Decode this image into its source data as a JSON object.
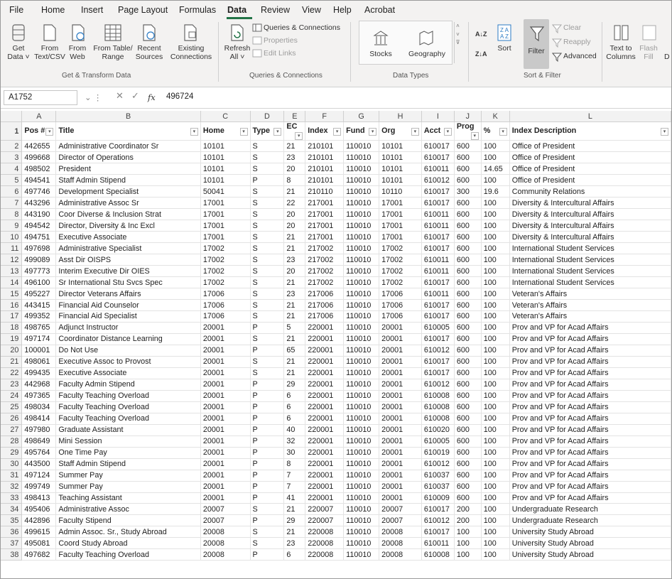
{
  "menu": {
    "tabs": [
      "File",
      "Home",
      "Insert",
      "Page Layout",
      "Formulas",
      "Data",
      "Review",
      "View",
      "Help",
      "Acrobat"
    ],
    "active": "Data"
  },
  "ribbon": {
    "get_data": [
      "Get",
      "Data ˅"
    ],
    "from_text": [
      "From",
      "Text/CSV"
    ],
    "from_web": [
      "From",
      "Web"
    ],
    "from_table": [
      "From Table/",
      "Range"
    ],
    "recent_sources": [
      "Recent",
      "Sources"
    ],
    "existing_connections": [
      "Existing",
      "Connections"
    ],
    "group_get_transform": "Get & Transform Data",
    "refresh_all": [
      "Refresh",
      "All ˅"
    ],
    "queries_connections": "Queries & Connections",
    "properties": "Properties",
    "edit_links": "Edit Links",
    "group_queries": "Queries & Connections",
    "stocks": "Stocks",
    "geography": "Geography",
    "group_data_types": "Data Types",
    "sort_az": "A↓Z",
    "sort_za": "Z↓A",
    "sort": "Sort",
    "filter": "Filter",
    "clear": "Clear",
    "reapply": "Reapply",
    "advanced": "Advanced",
    "group_sort_filter": "Sort & Filter",
    "text_to_columns": [
      "Text to",
      "Columns"
    ],
    "flash_fill": [
      "Flash",
      "Fill"
    ],
    "cut_letter": "D"
  },
  "formula_bar": {
    "name_box": "A1752",
    "fx": "fx",
    "value": "496724"
  },
  "columns": [
    "A",
    "B",
    "C",
    "D",
    "E",
    "F",
    "G",
    "H",
    "I",
    "J",
    "K",
    "L"
  ],
  "headers": [
    "Pos #",
    "Title",
    "Home",
    "Type",
    "EC",
    "Index",
    "Fund",
    "Org",
    "Acct",
    "Prog",
    "%",
    "Index Description"
  ],
  "rows": [
    [
      "442655",
      "Administrative Coordinator Sr",
      "10101",
      "S",
      "21",
      "210101",
      "110010",
      "10101",
      "610017",
      "600",
      "100",
      "Office of President"
    ],
    [
      "499668",
      "Director of Operations",
      "10101",
      "S",
      "23",
      "210101",
      "110010",
      "10101",
      "610017",
      "600",
      "100",
      "Office of President"
    ],
    [
      "498502",
      "President",
      "10101",
      "S",
      "20",
      "210101",
      "110010",
      "10101",
      "610011",
      "600",
      "14.65",
      "Office of President"
    ],
    [
      "494541",
      "Staff Admin Stipend",
      "10101",
      "P",
      "8",
      "210101",
      "110010",
      "10101",
      "610012",
      "600",
      "100",
      "Office of President"
    ],
    [
      "497746",
      "Development Specialist",
      "50041",
      "S",
      "21",
      "210110",
      "110010",
      "10110",
      "610017",
      "300",
      "19.6",
      "Community Relations"
    ],
    [
      "443296",
      "Administrative Assoc Sr",
      "17001",
      "S",
      "22",
      "217001",
      "110010",
      "17001",
      "610017",
      "600",
      "100",
      "Diversity & Intercultural Affairs"
    ],
    [
      "443190",
      "Coor Diverse & Inclusion Strat",
      "17001",
      "S",
      "20",
      "217001",
      "110010",
      "17001",
      "610011",
      "600",
      "100",
      "Diversity & Intercultural Affairs"
    ],
    [
      "494542",
      "Director, Diversity & Inc Excl",
      "17001",
      "S",
      "20",
      "217001",
      "110010",
      "17001",
      "610011",
      "600",
      "100",
      "Diversity & Intercultural Affairs"
    ],
    [
      "494751",
      "Executive Associate",
      "17001",
      "S",
      "21",
      "217001",
      "110010",
      "17001",
      "610017",
      "600",
      "100",
      "Diversity & Intercultural Affairs"
    ],
    [
      "497698",
      "Administrative Specialist",
      "17002",
      "S",
      "21",
      "217002",
      "110010",
      "17002",
      "610017",
      "600",
      "100",
      "International Student Services"
    ],
    [
      "499089",
      "Asst Dir OISPS",
      "17002",
      "S",
      "23",
      "217002",
      "110010",
      "17002",
      "610011",
      "600",
      "100",
      "International Student Services"
    ],
    [
      "497773",
      "Interim Executive Dir OIES",
      "17002",
      "S",
      "20",
      "217002",
      "110010",
      "17002",
      "610011",
      "600",
      "100",
      "International Student Services"
    ],
    [
      "496100",
      "Sr International Stu Svcs Spec",
      "17002",
      "S",
      "21",
      "217002",
      "110010",
      "17002",
      "610017",
      "600",
      "100",
      "International Student Services"
    ],
    [
      "495227",
      "Director Veterans Affairs",
      "17006",
      "S",
      "23",
      "217006",
      "110010",
      "17006",
      "610011",
      "600",
      "100",
      "Veteran's Affairs"
    ],
    [
      "443415",
      "Financial Aid Counselor",
      "17006",
      "S",
      "21",
      "217006",
      "110010",
      "17006",
      "610017",
      "600",
      "100",
      "Veteran's Affairs"
    ],
    [
      "499352",
      "Financial Aid Specialist",
      "17006",
      "S",
      "21",
      "217006",
      "110010",
      "17006",
      "610017",
      "600",
      "100",
      "Veteran's Affairs"
    ],
    [
      "498765",
      "Adjunct Instructor",
      "20001",
      "P",
      "5",
      "220001",
      "110010",
      "20001",
      "610005",
      "600",
      "100",
      "Prov and VP for Acad Affairs"
    ],
    [
      "497174",
      "Coordinator Distance Learning",
      "20001",
      "S",
      "21",
      "220001",
      "110010",
      "20001",
      "610017",
      "600",
      "100",
      "Prov and VP for Acad Affairs"
    ],
    [
      "100001",
      "Do Not Use",
      "20001",
      "P",
      "65",
      "220001",
      "110010",
      "20001",
      "610012",
      "600",
      "100",
      "Prov and VP for Acad Affairs"
    ],
    [
      "498061",
      "Executive Assoc to Provost",
      "20001",
      "S",
      "21",
      "220001",
      "110010",
      "20001",
      "610017",
      "600",
      "100",
      "Prov and VP for Acad Affairs"
    ],
    [
      "499435",
      "Executive Associate",
      "20001",
      "S",
      "21",
      "220001",
      "110010",
      "20001",
      "610017",
      "600",
      "100",
      "Prov and VP for Acad Affairs"
    ],
    [
      "442968",
      "Faculty Admin Stipend",
      "20001",
      "P",
      "29",
      "220001",
      "110010",
      "20001",
      "610012",
      "600",
      "100",
      "Prov and VP for Acad Affairs"
    ],
    [
      "497365",
      "Faculty Teaching Overload",
      "20001",
      "P",
      "6",
      "220001",
      "110010",
      "20001",
      "610008",
      "600",
      "100",
      "Prov and VP for Acad Affairs"
    ],
    [
      "498034",
      "Faculty Teaching Overload",
      "20001",
      "P",
      "6",
      "220001",
      "110010",
      "20001",
      "610008",
      "600",
      "100",
      "Prov and VP for Acad Affairs"
    ],
    [
      "498414",
      "Faculty Teaching Overload",
      "20001",
      "P",
      "6",
      "220001",
      "110010",
      "20001",
      "610008",
      "600",
      "100",
      "Prov and VP for Acad Affairs"
    ],
    [
      "497980",
      "Graduate Assistant",
      "20001",
      "P",
      "40",
      "220001",
      "110010",
      "20001",
      "610020",
      "600",
      "100",
      "Prov and VP for Acad Affairs"
    ],
    [
      "498649",
      "Mini Session",
      "20001",
      "P",
      "32",
      "220001",
      "110010",
      "20001",
      "610005",
      "600",
      "100",
      "Prov and VP for Acad Affairs"
    ],
    [
      "495764",
      "One Time Pay",
      "20001",
      "P",
      "30",
      "220001",
      "110010",
      "20001",
      "610019",
      "600",
      "100",
      "Prov and VP for Acad Affairs"
    ],
    [
      "443500",
      "Staff Admin Stipend",
      "20001",
      "P",
      "8",
      "220001",
      "110010",
      "20001",
      "610012",
      "600",
      "100",
      "Prov and VP for Acad Affairs"
    ],
    [
      "497124",
      "Summer Pay",
      "20001",
      "P",
      "7",
      "220001",
      "110010",
      "20001",
      "610037",
      "600",
      "100",
      "Prov and VP for Acad Affairs"
    ],
    [
      "499749",
      "Summer Pay",
      "20001",
      "P",
      "7",
      "220001",
      "110010",
      "20001",
      "610037",
      "600",
      "100",
      "Prov and VP for Acad Affairs"
    ],
    [
      "498413",
      "Teaching Assistant",
      "20001",
      "P",
      "41",
      "220001",
      "110010",
      "20001",
      "610009",
      "600",
      "100",
      "Prov and VP for Acad Affairs"
    ],
    [
      "495406",
      "Administrative Assoc",
      "20007",
      "S",
      "21",
      "220007",
      "110010",
      "20007",
      "610017",
      "200",
      "100",
      "Undergraduate Research"
    ],
    [
      "442896",
      "Faculty Stipend",
      "20007",
      "P",
      "29",
      "220007",
      "110010",
      "20007",
      "610012",
      "200",
      "100",
      "Undergraduate Research"
    ],
    [
      "499615",
      "Admin Assoc. Sr., Study Abroad",
      "20008",
      "S",
      "21",
      "220008",
      "110010",
      "20008",
      "610017",
      "100",
      "100",
      "University Study Abroad"
    ],
    [
      "495081",
      "Coord Study Abroad",
      "20008",
      "S",
      "23",
      "220008",
      "110010",
      "20008",
      "610011",
      "100",
      "100",
      "University Study Abroad"
    ],
    [
      "497682",
      "Faculty Teaching Overload",
      "20008",
      "P",
      "6",
      "220008",
      "110010",
      "20008",
      "610008",
      "100",
      "100",
      "University Study Abroad"
    ]
  ]
}
